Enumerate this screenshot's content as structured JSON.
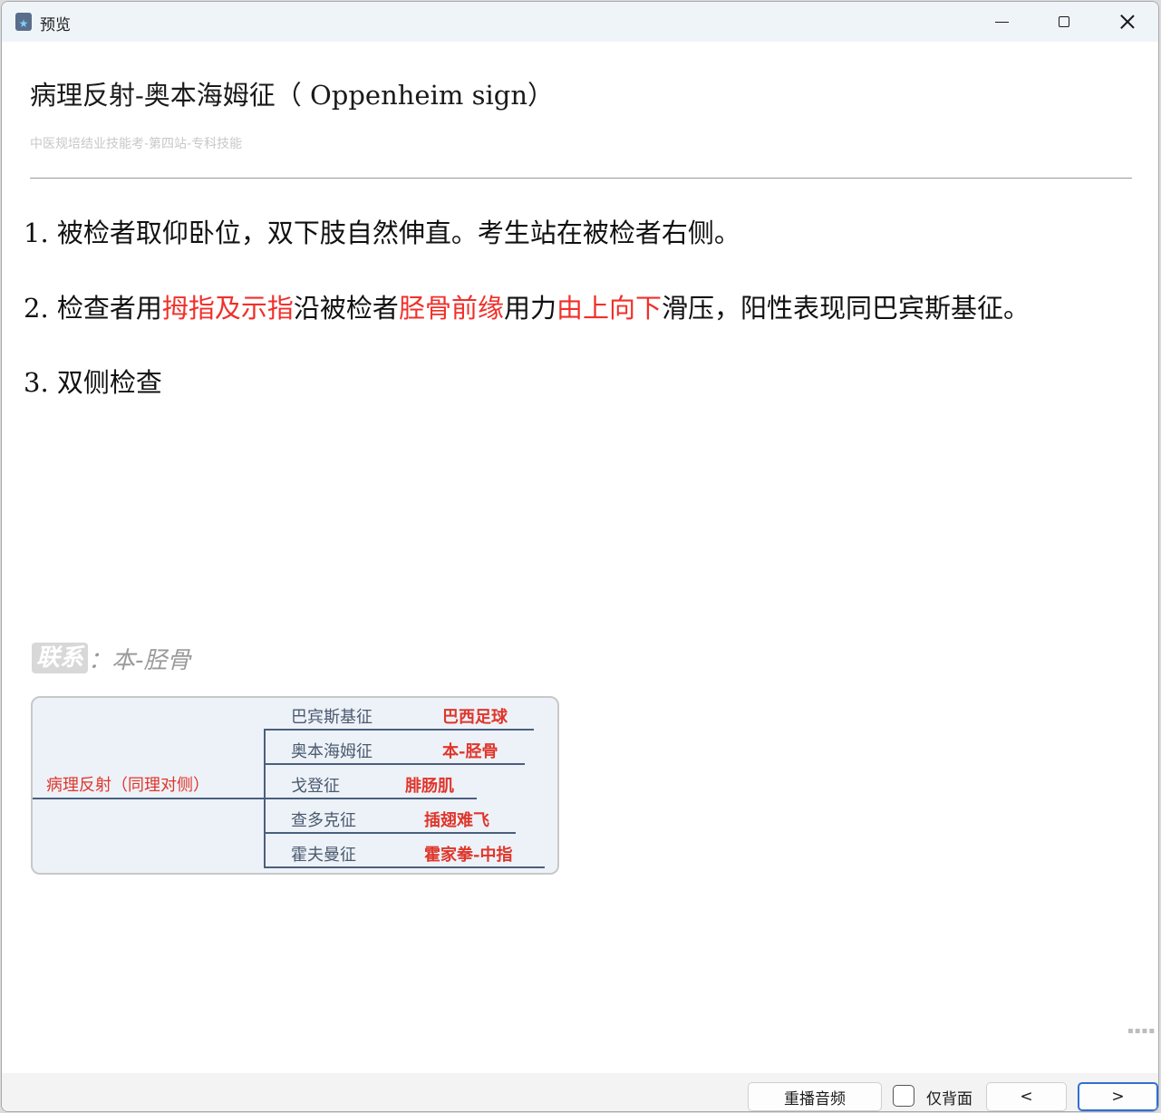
{
  "window": {
    "title": "预览"
  },
  "card": {
    "title": "病理反射-奥本海姆征（ Oppenheim sign）",
    "subtitle": "中医规培结业技能考-第四站-专科技能",
    "steps": [
      {
        "num": "1.",
        "parts": [
          {
            "text": "被检者取仰卧位，双下肢自然伸直。考生站在被检者右侧。",
            "red": false
          }
        ]
      },
      {
        "num": "2.",
        "parts": [
          {
            "text": "检查者用",
            "red": false
          },
          {
            "text": "拇指及示指",
            "red": true
          },
          {
            "text": "沿被检者",
            "red": false
          },
          {
            "text": "胫骨前缘",
            "red": true
          },
          {
            "text": "用力",
            "red": false
          },
          {
            "text": "由上向下",
            "red": true
          },
          {
            "text": "滑压，阳性表现同巴宾斯基征。",
            "red": false
          }
        ]
      },
      {
        "num": "3.",
        "parts": [
          {
            "text": "双侧检查",
            "red": false
          }
        ]
      }
    ],
    "link": {
      "badge": "联系",
      "separator": "：",
      "text": "本-胫骨"
    },
    "mindmap": {
      "root": "病理反射（同理对侧）",
      "branches": [
        {
          "sign": "巴宾斯基征",
          "mnemonic": "巴西足球"
        },
        {
          "sign": "奥本海姆征",
          "mnemonic": "本-胫骨"
        },
        {
          "sign": "戈登征",
          "mnemonic": "腓肠肌"
        },
        {
          "sign": "查多克征",
          "mnemonic": "插翅难飞"
        },
        {
          "sign": "霍夫曼征",
          "mnemonic": "霍家拳-中指"
        }
      ]
    }
  },
  "bottom": {
    "replay_label": "重播音频",
    "back_only_label": "仅背面",
    "prev_label": "<",
    "next_label": ">"
  },
  "colors": {
    "accent_red": "#f0302a",
    "focus_blue": "#2f6fd4"
  }
}
